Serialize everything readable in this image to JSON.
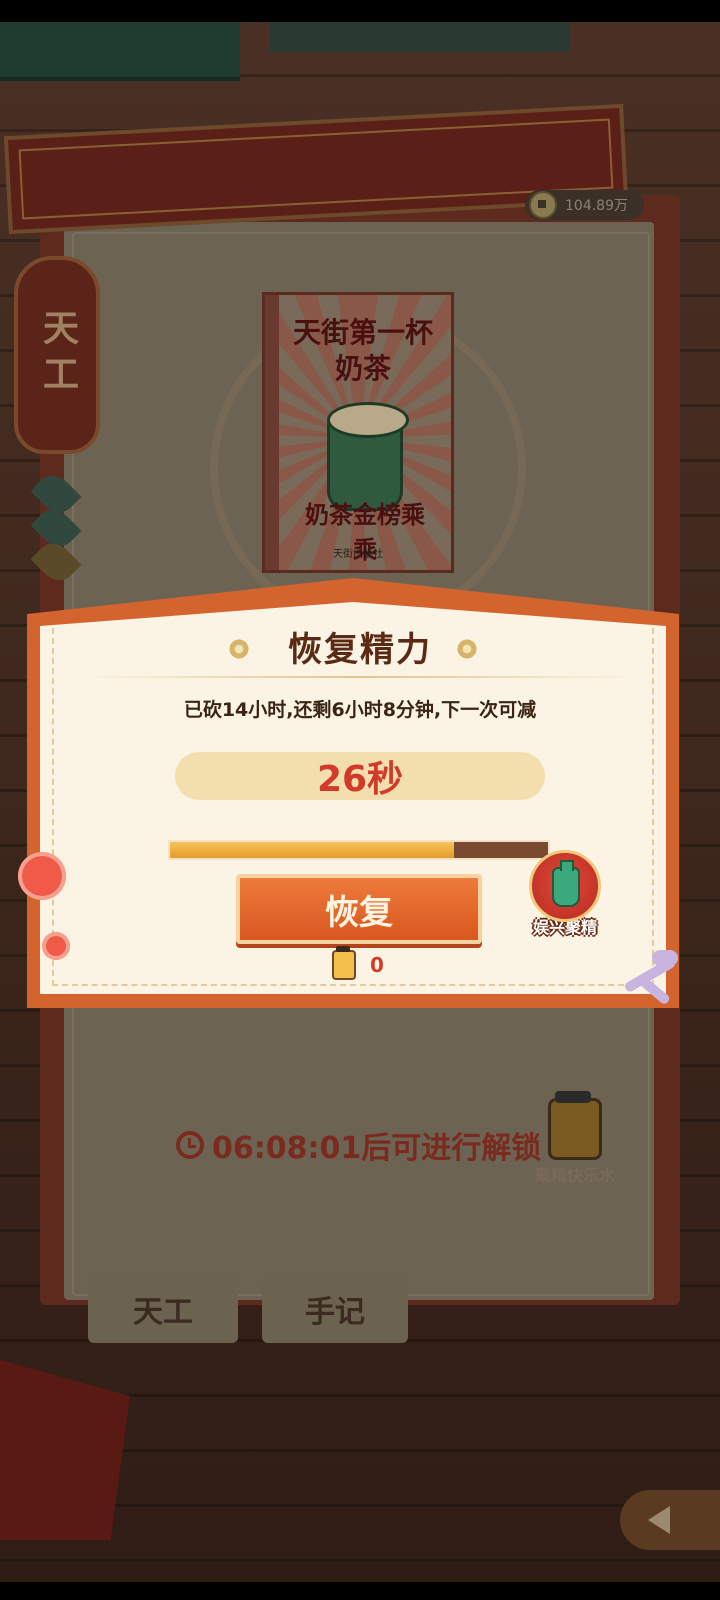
{
  "status": {
    "coins": "104.89万"
  },
  "side_tab": {
    "label": "天工"
  },
  "cover": {
    "title": "天街第一杯奶茶",
    "subtitle": "奶茶金榜乘乘",
    "publisher": "天街出版社"
  },
  "dialog": {
    "title": "恢复精力",
    "description": "已砍14小时,还剩6小时8分钟,下一次可减",
    "timer": "26秒",
    "progress_fraction": 0.75,
    "restore_label": "恢复",
    "cost_count": "0",
    "potion_label": "娱兴聚精"
  },
  "unlock": {
    "countdown_text": "06:08:01后可进行解锁"
  },
  "potion_right": {
    "label": "聚精快乐水"
  },
  "bottom_tabs": [
    {
      "label": "天工"
    },
    {
      "label": "手记"
    }
  ],
  "colors": {
    "accent": "#d4642e",
    "timer_text": "#d23b2a",
    "dialog_bg": "#fbf4e4"
  }
}
